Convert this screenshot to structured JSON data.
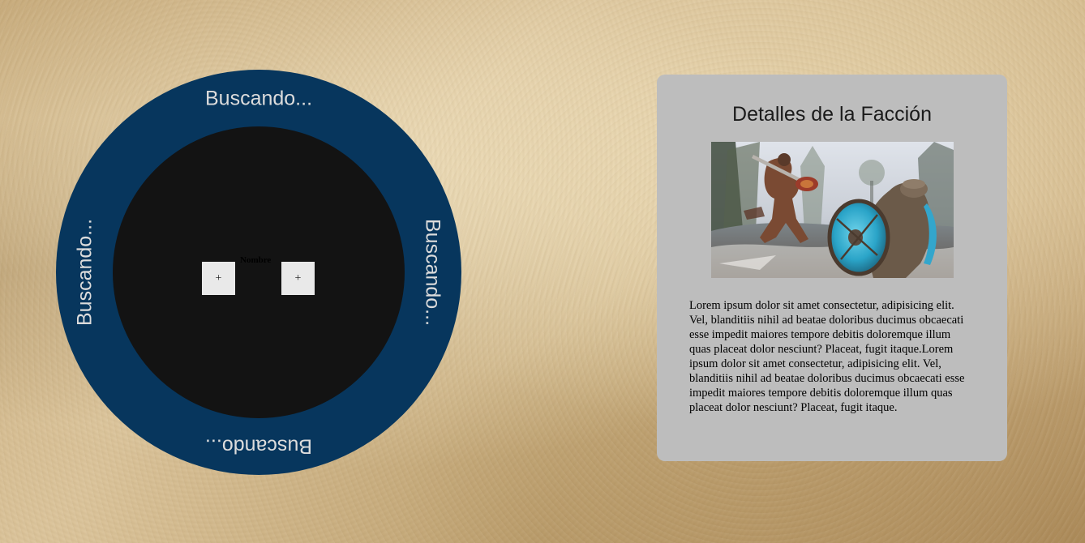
{
  "matchmaking": {
    "status_top": "Buscando...",
    "status_right": "Buscando...",
    "status_bottom": "Buscando...",
    "status_left": "Buscando...",
    "name_label": "Nombre",
    "add_left_label": "+",
    "add_right_label": "+"
  },
  "faction_details": {
    "title": "Detalles de la Facción",
    "image_icon": "knights-battle-image",
    "description": "Lorem ipsum dolor sit amet consectetur, adipisicing elit. Vel, blanditiis nihil ad beatae doloribus ducimus obcaecati esse impedit maiores tempore debitis doloremque illum quas placeat dolor nesciunt? Placeat, fugit itaque.Lorem ipsum dolor sit amet consectetur, adipisicing elit. Vel, blanditiis nihil ad beatae doloribus ducimus obcaecati esse impedit maiores tempore debitis doloremque illum quas placeat dolor nesciunt? Placeat, fugit itaque."
  },
  "colors": {
    "ring": "#07365d",
    "inner_disc": "#131313",
    "panel": "#bdbdbd",
    "slot_button": "#e9e9e9"
  }
}
